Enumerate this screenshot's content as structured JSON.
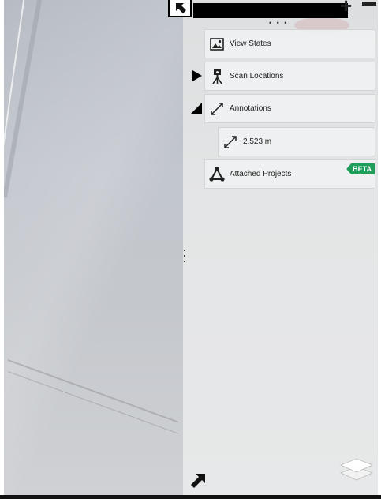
{
  "panel": {
    "items": [
      {
        "label": "View States",
        "icon": "image-icon"
      },
      {
        "label": "Scan Locations",
        "icon": "scanner-icon",
        "expander": "collapsed"
      },
      {
        "label": "Annotations",
        "icon": "measure-icon",
        "expander": "expanded"
      },
      {
        "label": "2.523 m",
        "icon": "measure-icon"
      },
      {
        "label": "Attached Projects",
        "icon": "network-icon",
        "badge": "BETA"
      }
    ]
  },
  "toolbar": {
    "dots": "• • •"
  },
  "colors": {
    "beta": "#1e9e5a"
  }
}
